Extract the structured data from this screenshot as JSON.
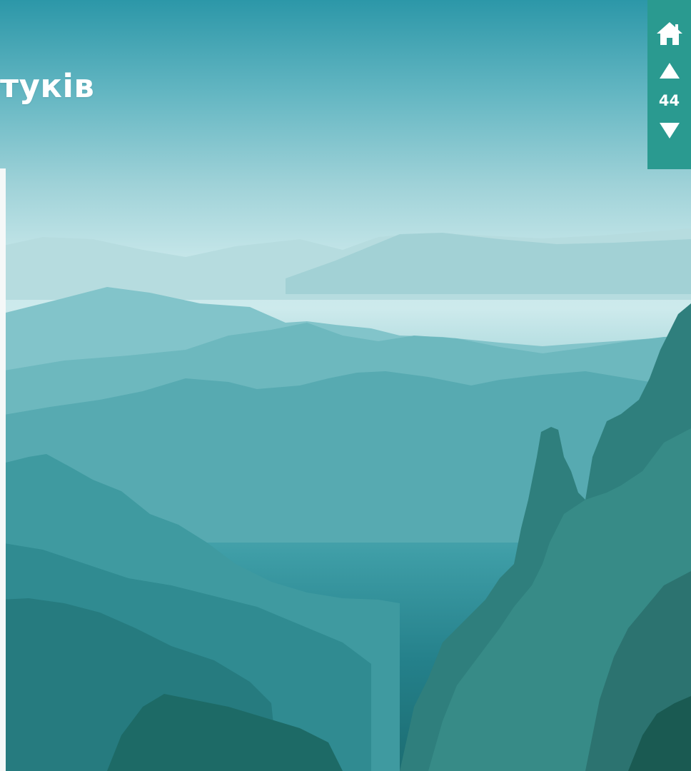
{
  "header": {
    "title": "тукiв"
  },
  "nav": {
    "home_icon": "home-icon",
    "up_icon": "triangle-up-icon",
    "page_number": "44",
    "down_icon": "triangle-down-icon",
    "background_color": "#2a9a90"
  },
  "background": {
    "image": "misty-mountain-landscape"
  }
}
